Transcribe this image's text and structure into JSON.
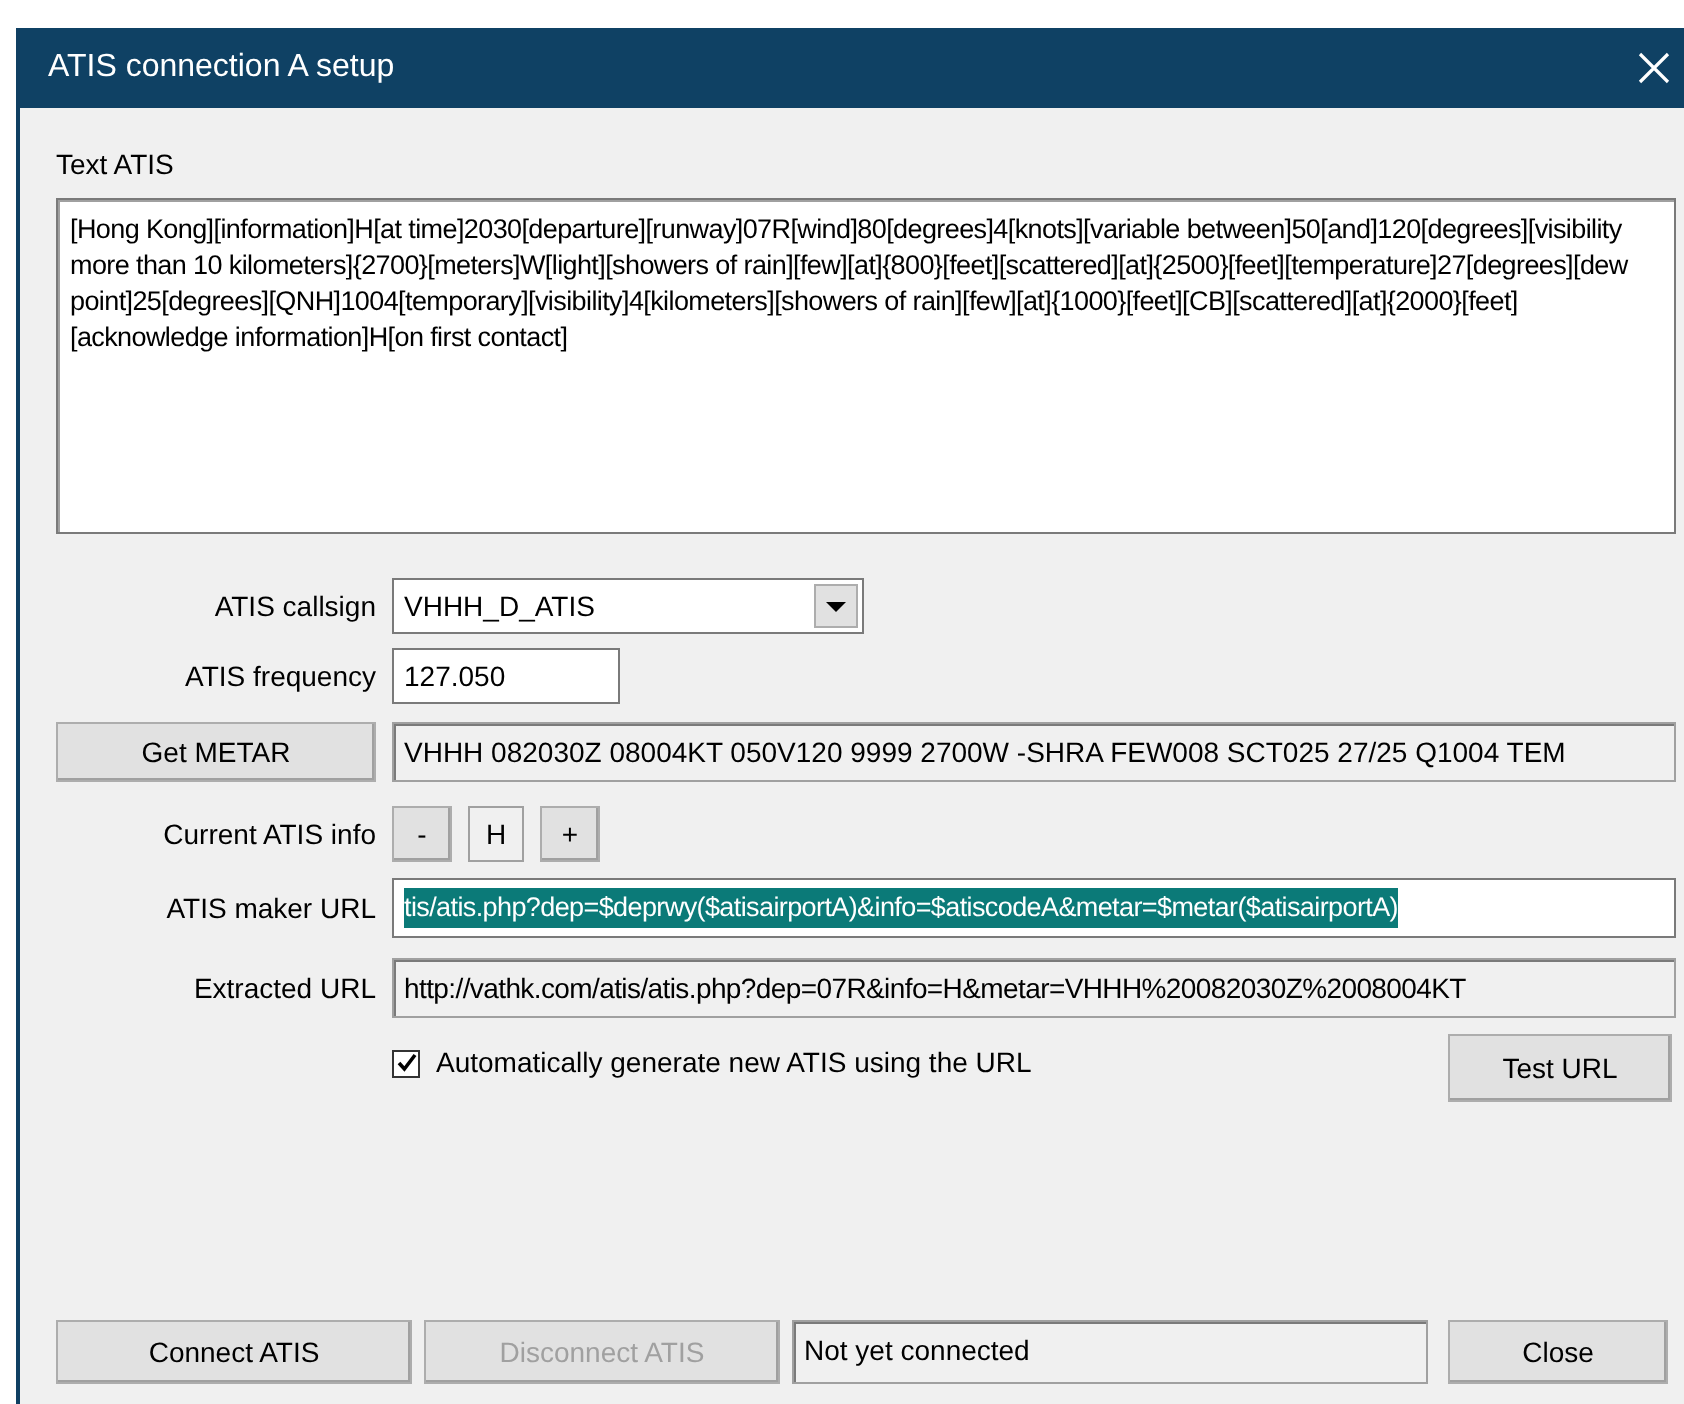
{
  "window": {
    "title": "ATIS connection A setup"
  },
  "text_atis": {
    "label": "Text ATIS",
    "value": "[Hong Kong][information]H[at time]2030[departure][runway]07R[wind]80[degrees]4[knots][variable between]50[and]120[degrees][visibility more than 10 kilometers]{2700}[meters]W[light][showers of rain][few][at]{800}[feet][scattered][at]{2500}[feet][temperature]27[degrees][dew point]25[degrees][QNH]1004[temporary][visibility]4[kilometers][showers of rain][few][at]{1000}[feet][CB][scattered][at]{2000}[feet][acknowledge information]H[on first contact]"
  },
  "callsign": {
    "label": "ATIS callsign",
    "value": "VHHH_D_ATIS"
  },
  "frequency": {
    "label": "ATIS frequency",
    "value": "127.050"
  },
  "metar": {
    "button": "Get METAR",
    "value": "VHHH 082030Z 08004KT 050V120 9999 2700W -SHRA FEW008 SCT025 27/25 Q1004 TEM"
  },
  "current_info": {
    "label": "Current ATIS info",
    "minus": "-",
    "value": "H",
    "plus": "+"
  },
  "maker_url": {
    "label": "ATIS maker URL",
    "value": "tis/atis.php?dep=$deprwy($atisairportA)&info=$atiscodeA&metar=$metar($atisairportA)",
    "text_selected": true
  },
  "extracted_url": {
    "label": "Extracted URL",
    "value": "http://vathk.com/atis/atis.php?dep=07R&info=H&metar=VHHH%20082030Z%2008004KT"
  },
  "auto_generate": {
    "label": "Automatically generate new ATIS using the URL",
    "checked": true
  },
  "test_button": "Test URL",
  "bottom_buttons": [
    {
      "label": "Connect ATIS",
      "disabled": false
    },
    {
      "label": "Disconnect ATIS",
      "disabled": true
    }
  ],
  "status": "Not yet connected",
  "close_button": "Close"
}
